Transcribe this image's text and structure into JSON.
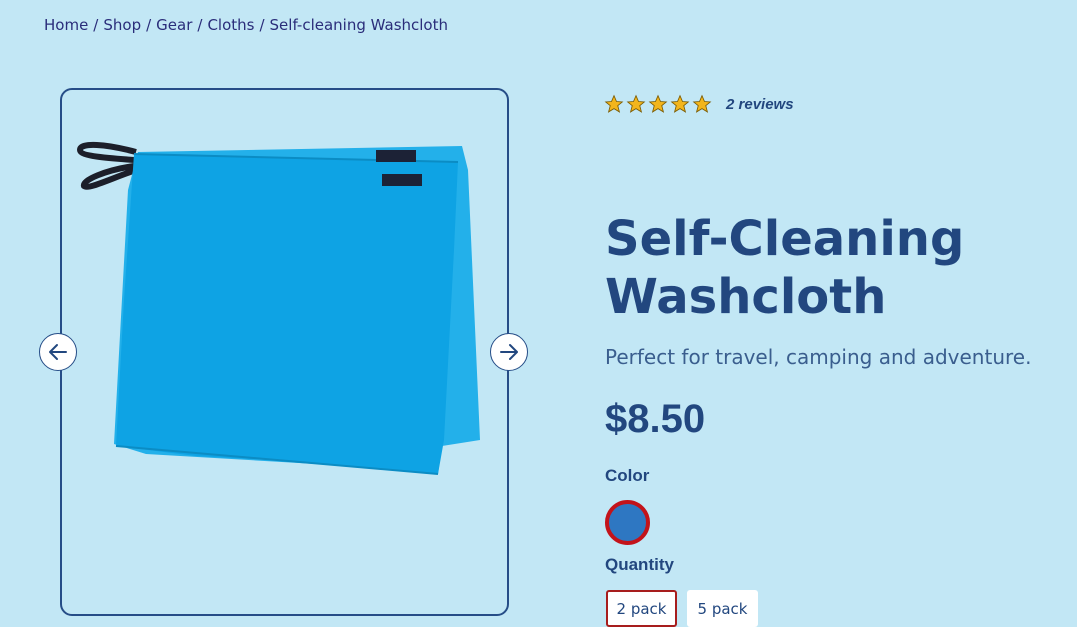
{
  "breadcrumb": {
    "home": "Home",
    "shop": "Shop",
    "gear": "Gear",
    "cloths": "Cloths",
    "current": "Self-cleaning Washcloth",
    "separator": "/"
  },
  "gallery": {
    "prev_icon": "arrow-left-icon",
    "next_icon": "arrow-right-icon",
    "image": "blue washcloth product photo",
    "image_color": "#0ea3e4"
  },
  "rating": {
    "stars": 5,
    "reviews": "2 reviews",
    "star_color": "#f2b51c"
  },
  "product": {
    "title_line1": "Self-Cleaning",
    "title_line2": "Washcloth",
    "subtitle": "Perfect for travel, camping and adventure.",
    "price": "$8.50"
  },
  "options": {
    "color_label": "Color",
    "color_swatch": "#2e77c2",
    "quantity_label": "Quantity",
    "quantities": [
      "2 pack",
      "5 pack"
    ],
    "selected_quantity": "2 pack"
  },
  "colors": {
    "background": "#c2e7f5",
    "primary": "#22477f",
    "selected_border": "#a71d1d"
  }
}
